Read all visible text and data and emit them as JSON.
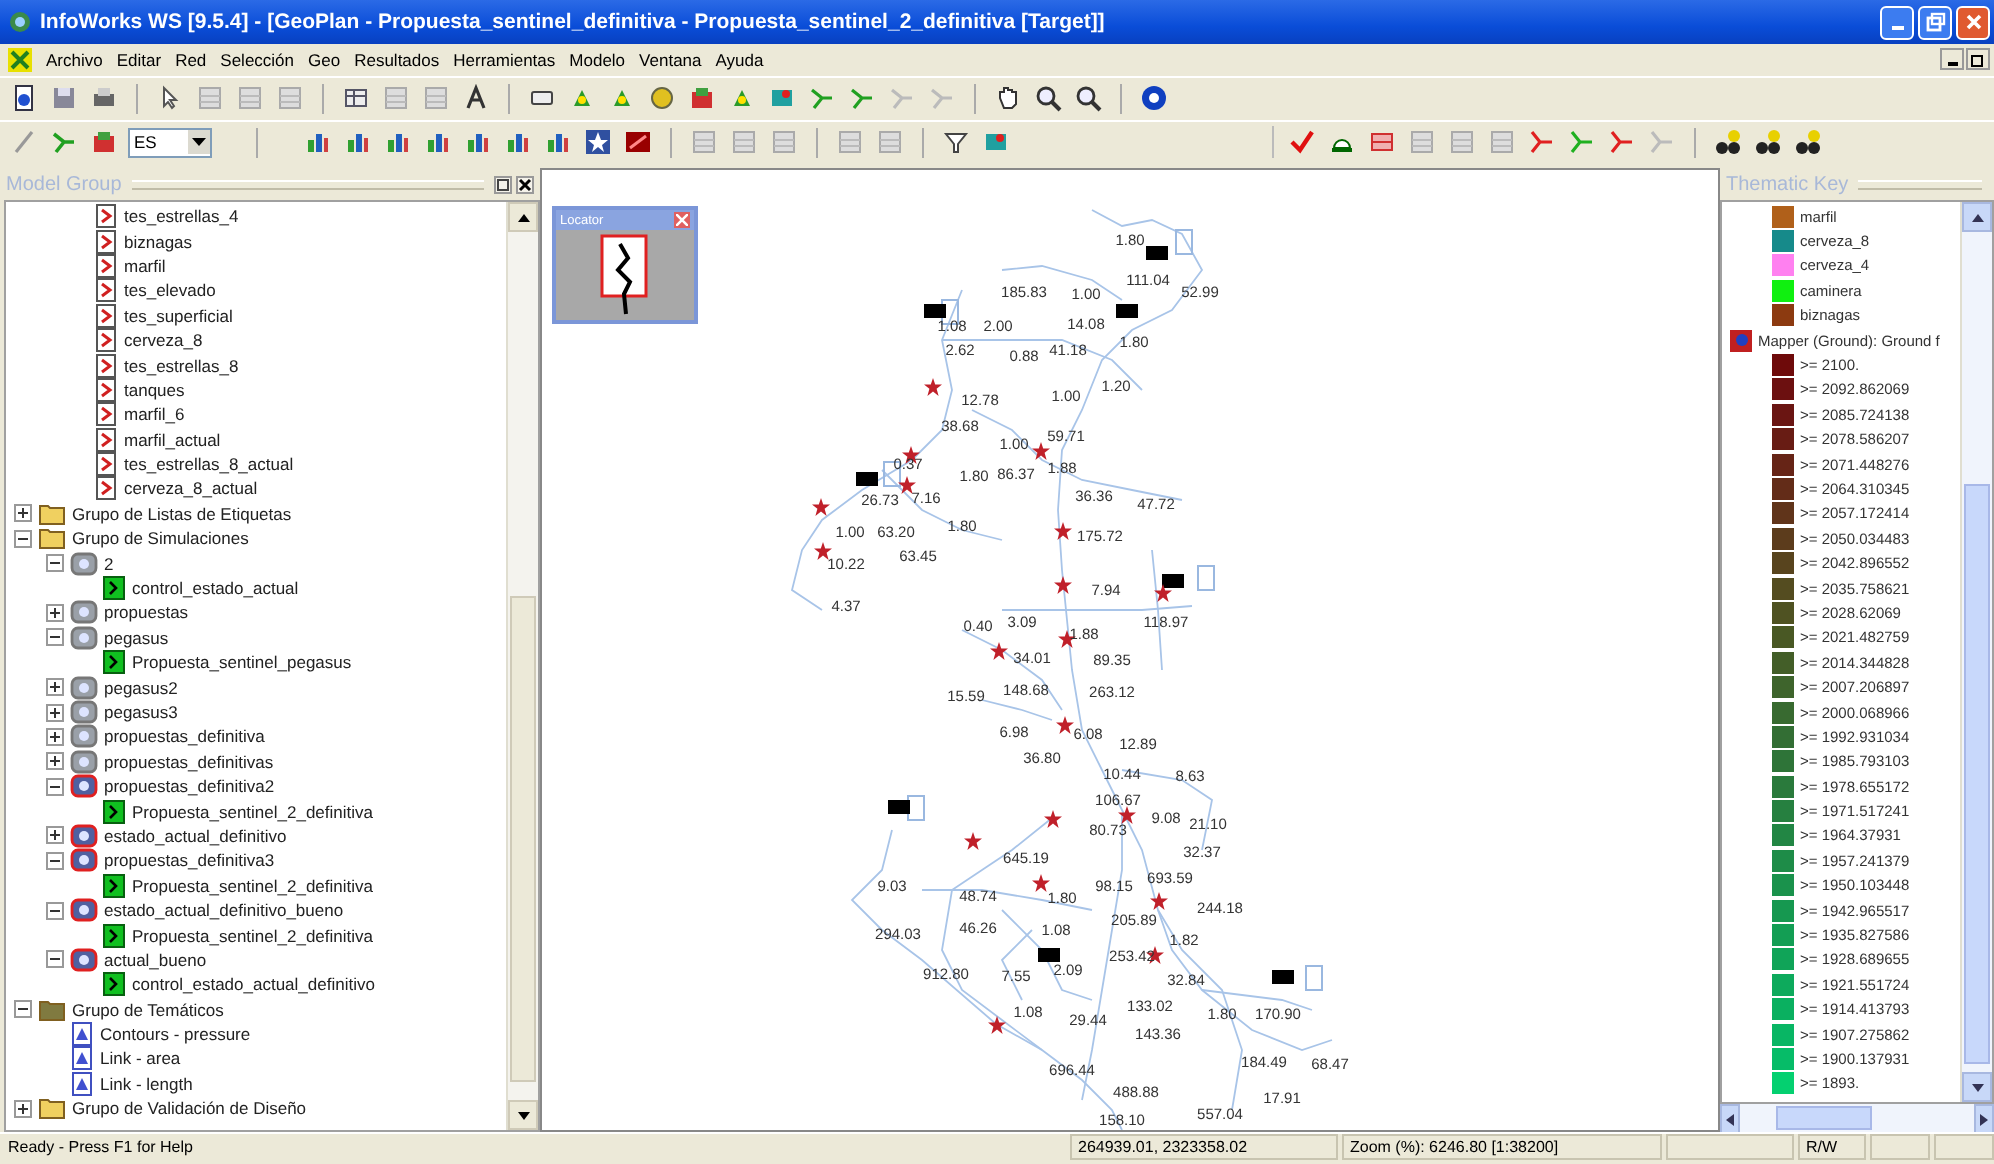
{
  "window": {
    "title": "InfoWorks WS [9.5.4] - [GeoPlan - Propuesta_sentinel_definitiva - Propuesta_sentinel_2_definitiva [Target]]"
  },
  "menu": [
    "Archivo",
    "Editar",
    "Red",
    "Selección",
    "Geo",
    "Resultados",
    "Herramientas",
    "Modelo",
    "Ventana",
    "Ayuda"
  ],
  "toolbar": {
    "dropdown": {
      "value": "ES"
    }
  },
  "model_group": {
    "title": "Model Group",
    "scrolled_items": [
      {
        "label": "tes_estrellas_4",
        "kind": "network"
      },
      {
        "label": "biznagas",
        "kind": "network"
      },
      {
        "label": "marfil",
        "kind": "network"
      },
      {
        "label": "tes_elevado",
        "kind": "network"
      },
      {
        "label": "tes_superficial",
        "kind": "network"
      },
      {
        "label": "cerveza_8",
        "kind": "network"
      },
      {
        "label": "tes_estrellas_8",
        "kind": "network"
      },
      {
        "label": "tanques",
        "kind": "network"
      },
      {
        "label": "marfil_6",
        "kind": "network"
      },
      {
        "label": "marfil_actual",
        "kind": "network"
      },
      {
        "label": "tes_estrellas_8_actual",
        "kind": "network"
      },
      {
        "label": "cerveza_8_actual",
        "kind": "network"
      }
    ],
    "items": [
      {
        "label": "Grupo de Listas de Etiquetas",
        "kind": "folder",
        "expanded": false
      },
      {
        "label": "Grupo de Simulaciones",
        "kind": "folder",
        "expanded": true,
        "children": [
          {
            "label": "2",
            "kind": "run",
            "expanded": true,
            "children": [
              {
                "label": "control_estado_actual",
                "kind": "sim"
              }
            ]
          },
          {
            "label": "propuestas",
            "kind": "run",
            "expanded": false
          },
          {
            "label": "pegasus",
            "kind": "run",
            "expanded": true,
            "children": [
              {
                "label": "Propuesta_sentinel_pegasus",
                "kind": "sim"
              }
            ]
          },
          {
            "label": "pegasus2",
            "kind": "run",
            "expanded": false
          },
          {
            "label": "pegasus3",
            "kind": "run",
            "expanded": false
          },
          {
            "label": "propuestas_definitiva",
            "kind": "run",
            "expanded": false
          },
          {
            "label": "propuestas_definitivas",
            "kind": "run",
            "expanded": false
          },
          {
            "label": "propuestas_definitiva2",
            "kind": "run_flagged",
            "expanded": true,
            "children": [
              {
                "label": "Propuesta_sentinel_2_definitiva",
                "kind": "sim"
              }
            ]
          },
          {
            "label": "estado_actual_definitivo",
            "kind": "run_flagged",
            "expanded": false
          },
          {
            "label": "propuestas_definitiva3",
            "kind": "run_flagged",
            "expanded": true,
            "children": [
              {
                "label": "Propuesta_sentinel_2_definitiva",
                "kind": "sim"
              }
            ]
          },
          {
            "label": "estado_actual_definitivo_bueno",
            "kind": "run_flagged",
            "expanded": true,
            "children": [
              {
                "label": "Propuesta_sentinel_2_definitiva",
                "kind": "sim"
              }
            ]
          },
          {
            "label": "actual_bueno",
            "kind": "run_flagged",
            "expanded": true,
            "children": [
              {
                "label": "control_estado_actual_definitivo",
                "kind": "sim"
              }
            ]
          }
        ]
      },
      {
        "label": "Grupo de Temáticos",
        "kind": "theme_folder",
        "expanded": true,
        "children": [
          {
            "label": "Contours - pressure",
            "kind": "theme"
          },
          {
            "label": "Link - area",
            "kind": "theme"
          },
          {
            "label": "Link - length",
            "kind": "theme"
          }
        ]
      },
      {
        "label": "Grupo de Validación de Diseño",
        "kind": "folder",
        "expanded": false
      }
    ]
  },
  "locator": {
    "title": "Locator"
  },
  "map": {
    "labels": [
      "1.80",
      "111.04",
      "185.83",
      "1.00",
      "52.99",
      "1.08",
      "2.00",
      "14.08",
      "2.62",
      "0.88",
      "41.18",
      "1.80",
      "12.78",
      "1.00",
      "1.20",
      "38.68",
      "1.00",
      "59.71",
      "0.37",
      "1.80",
      "86.37",
      "1.88",
      "26.73",
      "7.16",
      "36.36",
      "47.72",
      "1.00",
      "63.20",
      "1.80",
      "175.72",
      "10.22",
      "63.45",
      "7.94",
      "118.97",
      "4.37",
      "0.40",
      "3.09",
      "1.88",
      "34.01",
      "89.35",
      "15.59",
      "148.68",
      "263.12",
      "6.98",
      "6.08",
      "12.89",
      "36.80",
      "10.44",
      "8.63",
      "106.67",
      "80.73",
      "9.08",
      "21.10",
      "32.37",
      "645.19",
      "9.03",
      "98.15",
      "693.59",
      "48.74",
      "1.80",
      "244.18",
      "294.03",
      "46.26",
      "1.08",
      "205.89",
      "1.82",
      "253.42",
      "912.80",
      "7.55",
      "2.09",
      "32.84",
      "1.08",
      "29.44",
      "133.02",
      "1.80",
      "170.90",
      "143.36",
      "184.49",
      "68.47",
      "696.44",
      "488.88",
      "17.91",
      "158.10",
      "557.04"
    ]
  },
  "thematic_key": {
    "title": "Thematic Key",
    "items": [
      {
        "label": "marfil",
        "color": "#b0601a"
      },
      {
        "label": "cerveza_8",
        "color": "#168a8a"
      },
      {
        "label": "cerveza_4",
        "color": "#ff80f0"
      },
      {
        "label": "caminera",
        "color": "#10f010"
      },
      {
        "label": "biznagas",
        "color": "#8c3a10"
      }
    ],
    "mapper": {
      "label": "Mapper (Ground): Ground f"
    },
    "ranges": [
      {
        "label": ">= 2100.",
        "color": "#6e0a0a"
      },
      {
        "label": ">= 2092.862069",
        "color": "#6c1010"
      },
      {
        "label": ">= 2085.724138",
        "color": "#6a1512"
      },
      {
        "label": ">= 2078.586207",
        "color": "#681c14"
      },
      {
        "label": ">= 2071.448276",
        "color": "#662416"
      },
      {
        "label": ">= 2064.310345",
        "color": "#632c18"
      },
      {
        "label": ">= 2057.172414",
        "color": "#60341a"
      },
      {
        "label": ">= 2050.034483",
        "color": "#5c3c1c"
      },
      {
        "label": ">= 2042.896552",
        "color": "#58441e"
      },
      {
        "label": ">= 2035.758621",
        "color": "#544c20"
      },
      {
        "label": ">= 2028.62069",
        "color": "#4f5222"
      },
      {
        "label": ">= 2021.482759",
        "color": "#495824"
      },
      {
        "label": ">= 2014.344828",
        "color": "#435e28"
      },
      {
        "label": ">= 2007.206897",
        "color": "#3e642c"
      },
      {
        "label": ">= 2000.068966",
        "color": "#386a30"
      },
      {
        "label": ">= 1992.931034",
        "color": "#336e34"
      },
      {
        "label": ">= 1985.793103",
        "color": "#2e7438"
      },
      {
        "label": ">= 1978.655172",
        "color": "#2a7a3c"
      },
      {
        "label": ">= 1971.517241",
        "color": "#268040"
      },
      {
        "label": ">= 1964.37931",
        "color": "#228644"
      },
      {
        "label": ">= 1957.241379",
        "color": "#1e8c48"
      },
      {
        "label": ">= 1950.103448",
        "color": "#1a924c"
      },
      {
        "label": ">= 1942.965517",
        "color": "#169850"
      },
      {
        "label": ">= 1935.827586",
        "color": "#139e54"
      },
      {
        "label": ">= 1928.689655",
        "color": "#10a458"
      },
      {
        "label": ">= 1921.551724",
        "color": "#0daa5c"
      },
      {
        "label": ">= 1914.413793",
        "color": "#0ab060"
      },
      {
        "label": ">= 1907.275862",
        "color": "#08b664"
      },
      {
        "label": ">= 1900.137931",
        "color": "#06bc68"
      },
      {
        "label": ">= 1893.",
        "color": "#04d070"
      }
    ]
  },
  "status_bar": {
    "message": "Ready - Press F1 for Help",
    "coordinates": "264939.01, 2323358.02",
    "zoom": "Zoom (%): 6246.80 [1:38200]",
    "mode": "R/W"
  }
}
